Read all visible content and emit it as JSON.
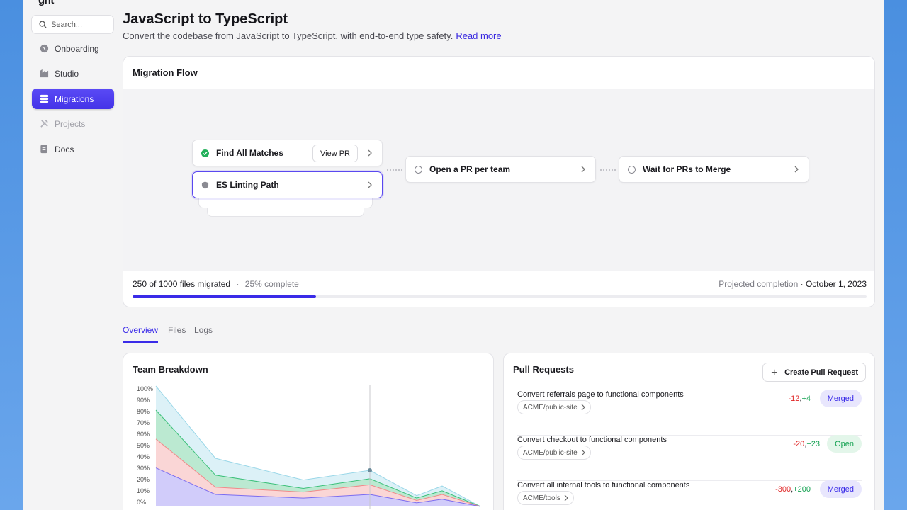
{
  "app": {
    "logo": "gnt"
  },
  "sidebar": {
    "search_placeholder": "Search...",
    "items": [
      {
        "label": "Onboarding",
        "icon": "globe-icon",
        "state": "normal"
      },
      {
        "label": "Studio",
        "icon": "factory-icon",
        "state": "normal"
      },
      {
        "label": "Migrations",
        "icon": "database-icon",
        "state": "active"
      },
      {
        "label": "Projects",
        "icon": "tools-icon",
        "state": "disabled"
      },
      {
        "label": "Docs",
        "icon": "doc-icon",
        "state": "normal"
      }
    ]
  },
  "header": {
    "title": "JavaScript to TypeScript",
    "subtitle": "Convert the codebase from JavaScript to TypeScript, with end-to-end type safety.",
    "read_more": "Read more"
  },
  "flow": {
    "title": "Migration Flow",
    "nodes": {
      "find_matches": {
        "label": "Find All Matches",
        "action": "View PR",
        "status": "complete"
      },
      "es_linting": {
        "label": "ES Linting Path",
        "status": "selected"
      },
      "open_pr": {
        "label": "Open a PR per team",
        "status": "pending"
      },
      "wait_prs": {
        "label": "Wait for PRs to Merge",
        "status": "pending"
      }
    },
    "progress": {
      "text": "250 of 1000 files migrated",
      "separator": "·",
      "percent_text": "25% complete",
      "fraction": 0.25,
      "projected_label": "Projected completion",
      "projected_date": "October 1, 2023"
    }
  },
  "tabs": [
    {
      "label": "Overview",
      "active": true
    },
    {
      "label": "Files",
      "active": false
    },
    {
      "label": "Logs",
      "active": false
    }
  ],
  "team_breakdown": {
    "title": "Team Breakdown",
    "chart_data": {
      "type": "area",
      "x": [
        0,
        1,
        2,
        3,
        4,
        5,
        6
      ],
      "ylim": [
        0,
        100
      ],
      "ytick_labels": [
        "100%",
        "90%",
        "80%",
        "70%",
        "60%",
        "50%",
        "40%",
        "30%",
        "20%",
        "10%",
        "0%"
      ],
      "series": [
        {
          "values": [
            32,
            10,
            7,
            10,
            3,
            6,
            0
          ],
          "color": "#7b6cf0"
        },
        {
          "values": [
            24,
            6,
            5,
            8,
            2,
            4,
            0
          ],
          "color": "#f08a8a"
        },
        {
          "values": [
            24,
            10,
            3,
            5,
            2,
            3,
            0
          ],
          "color": "#3cc07a"
        },
        {
          "values": [
            20,
            14,
            7,
            7,
            2,
            4,
            0
          ],
          "color": "#9ad7e8"
        }
      ],
      "highlight_x": 3
    }
  },
  "pull_requests": {
    "title": "Pull Requests",
    "create_label": "Create Pull Request",
    "items": [
      {
        "title": "Convert referrals page to functional components",
        "repo": "ACME/public-site",
        "del": "-12",
        "add": "+4",
        "status": "Merged"
      },
      {
        "title": "Convert checkout to functional components",
        "repo": "ACME/public-site",
        "del": "-20",
        "add": "+23",
        "status": "Open"
      },
      {
        "title": "Convert all internal tools to functional components",
        "repo": "ACME/tools",
        "del": "-300",
        "add": "+200",
        "status": "Merged"
      }
    ]
  },
  "colors": {
    "accent": "#3a2be8",
    "delete": "#e02424",
    "add": "#12a150"
  }
}
